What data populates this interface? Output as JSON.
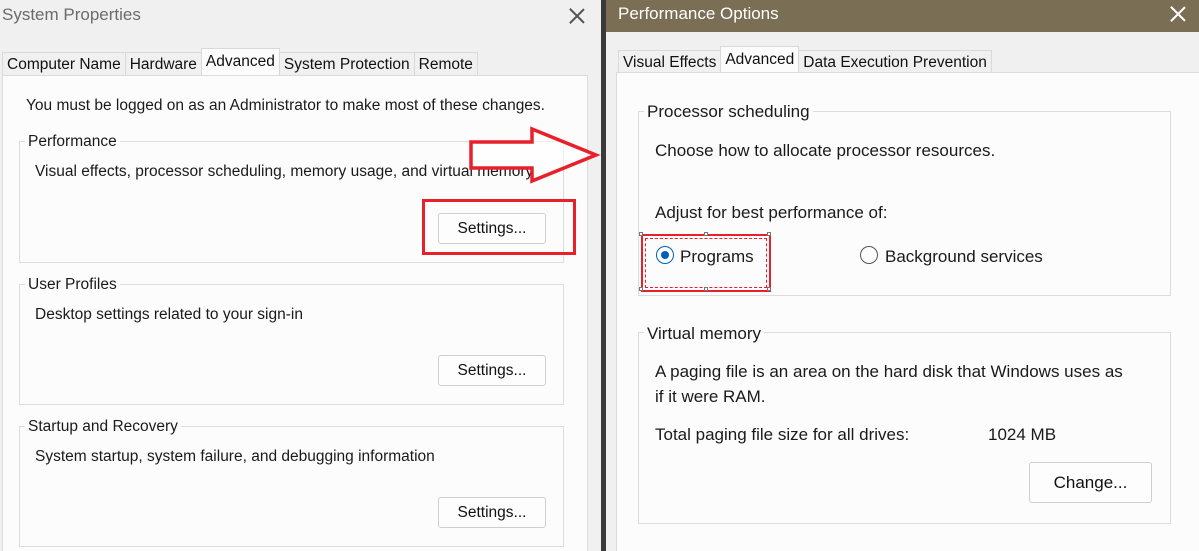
{
  "system_properties": {
    "title": "System Properties",
    "tabs": [
      "Computer Name",
      "Hardware",
      "Advanced",
      "System Protection",
      "Remote"
    ],
    "active_tab": "Advanced",
    "admin_note": "You must be logged on as an Administrator to make most of these changes.",
    "performance": {
      "title": "Performance",
      "description": "Visual effects, processor scheduling, memory usage, and virtual memory",
      "button": "Settings..."
    },
    "user_profiles": {
      "title": "User Profiles",
      "description": "Desktop settings related to your sign-in",
      "button": "Settings..."
    },
    "startup_recovery": {
      "title": "Startup and Recovery",
      "description": "System startup, system failure, and debugging information",
      "button": "Settings..."
    }
  },
  "performance_options": {
    "title": "Performance Options",
    "tabs": [
      "Visual Effects",
      "Advanced",
      "Data Execution Prevention"
    ],
    "active_tab": "Advanced",
    "processor_scheduling": {
      "title": "Processor scheduling",
      "description": "Choose how to allocate processor resources.",
      "adjust_label": "Adjust for best performance of:",
      "options": [
        "Programs",
        "Background services"
      ],
      "selected": "Programs"
    },
    "virtual_memory": {
      "title": "Virtual memory",
      "description_line1": "A paging file is an area on the hard disk that Windows uses as",
      "description_line2": "if it were RAM.",
      "total_label": "Total paging file size for all drives:",
      "total_value": "1024 MB",
      "button": "Change..."
    }
  },
  "colors": {
    "highlight_red": "#e8202a",
    "radio_blue": "#005fb8",
    "titlebar_right": "#7a6e55"
  }
}
